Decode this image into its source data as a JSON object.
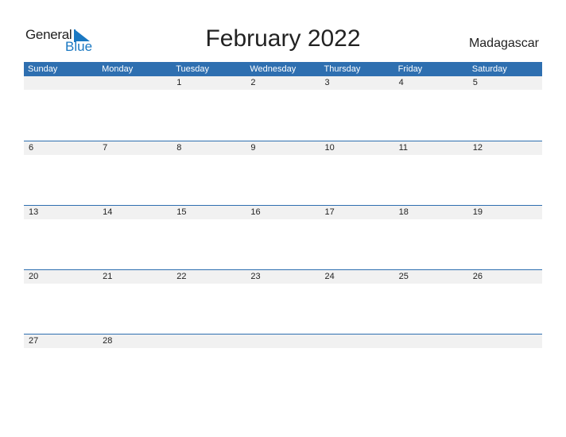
{
  "logo": {
    "general": "General",
    "blue": "Blue"
  },
  "title": "February 2022",
  "country": "Madagascar",
  "days": [
    "Sunday",
    "Monday",
    "Tuesday",
    "Wednesday",
    "Thursday",
    "Friday",
    "Saturday"
  ],
  "weeks": [
    [
      "",
      "",
      "1",
      "2",
      "3",
      "4",
      "5"
    ],
    [
      "6",
      "7",
      "8",
      "9",
      "10",
      "11",
      "12"
    ],
    [
      "13",
      "14",
      "15",
      "16",
      "17",
      "18",
      "19"
    ],
    [
      "20",
      "21",
      "22",
      "23",
      "24",
      "25",
      "26"
    ],
    [
      "27",
      "28",
      "",
      "",
      "",
      "",
      ""
    ]
  ],
  "colors": {
    "accent": "#2e6fb0",
    "logo_blue": "#1a78c2",
    "date_bar": "#f1f1f1"
  }
}
